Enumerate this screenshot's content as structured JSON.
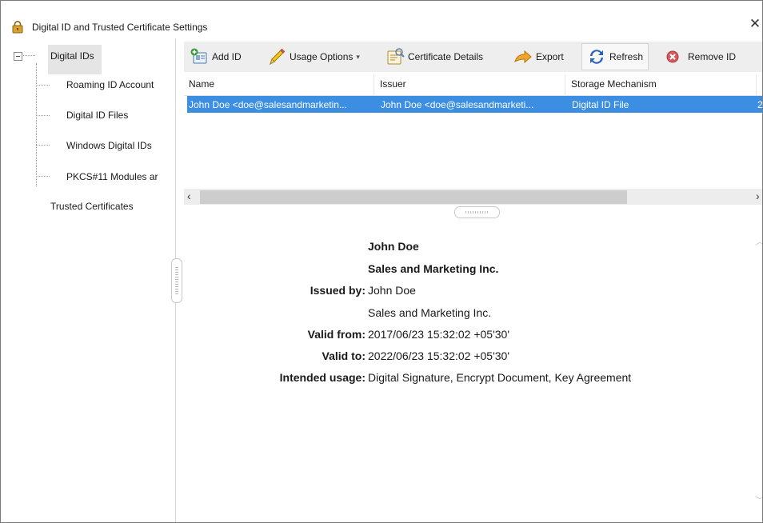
{
  "window": {
    "title": "Digital ID and Trusted Certificate Settings",
    "close_glyph": "✕"
  },
  "sidebar": {
    "items": [
      {
        "label": "Digital IDs"
      },
      {
        "label": "Roaming ID Account"
      },
      {
        "label": "Digital ID Files"
      },
      {
        "label": "Windows Digital IDs"
      },
      {
        "label": "PKCS#11 Modules ar"
      },
      {
        "label": "Trusted Certificates"
      }
    ]
  },
  "toolbar": {
    "add_id": "Add ID",
    "usage_options": "Usage Options",
    "certificate_details": "Certificate Details",
    "export": "Export",
    "refresh": "Refresh",
    "remove_id": "Remove ID"
  },
  "table": {
    "columns": [
      "Name",
      "Issuer",
      "Storage Mechanism"
    ],
    "rows": [
      {
        "name": "John Doe <doe@salesandmarketin...",
        "issuer": "John Doe <doe@salesandmarketi...",
        "storage": "Digital ID File",
        "overflow": "2"
      }
    ]
  },
  "details": {
    "name": "John Doe",
    "organization": "Sales and Marketing Inc.",
    "issued_by_label": "Issued by:",
    "issued_by_name": "John Doe",
    "issued_by_org": "Sales and Marketing Inc.",
    "valid_from_label": "Valid from:",
    "valid_from": "2017/06/23 15:32:02 +05'30'",
    "valid_to_label": "Valid to:",
    "valid_to": "2022/06/23 15:32:02 +05'30'",
    "usage_label": "Intended usage:",
    "usage": "Digital Signature, Encrypt Document, Key Agreement"
  },
  "colors": {
    "selection": "#3b8ee2",
    "toolbar": "#eeeeee",
    "remove_icon": "#d85a5a",
    "export_icon": "#f0a52b",
    "refresh_icon": "#2b62b8"
  },
  "icons": [
    "lock-icon",
    "add-id-icon",
    "usage-options-pencil-icon",
    "certificate-details-icon",
    "export-arrow-icon",
    "refresh-icon",
    "remove-id-icon"
  ]
}
